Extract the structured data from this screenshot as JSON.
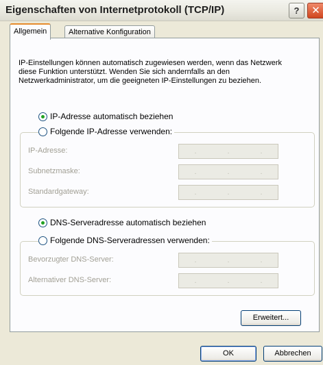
{
  "window": {
    "title": "Eigenschaften von Internetprotokoll (TCP/IP)",
    "help_button": "?",
    "close_button": "✕"
  },
  "tabs": [
    {
      "label": "Allgemein",
      "active": true
    },
    {
      "label": "Alternative Konfiguration",
      "active": false
    }
  ],
  "intro_text": "IP-Einstellungen können automatisch zugewiesen werden, wenn das Netzwerk diese Funktion unterstützt. Wenden Sie sich andernfalls an den Netzwerkadministrator, um die geeigneten IP-Einstellungen zu beziehen.",
  "ip_section": {
    "auto_option": "IP-Adresse automatisch beziehen",
    "manual_option": "Folgende IP-Adresse verwenden:",
    "selected": "auto",
    "fields": [
      {
        "label": "IP-Adresse:"
      },
      {
        "label": "Subnetzmaske:"
      },
      {
        "label": "Standardgateway:"
      }
    ]
  },
  "dns_section": {
    "auto_option": "DNS-Serveradresse automatisch beziehen",
    "manual_option": "Folgende DNS-Serveradressen verwenden:",
    "selected": "auto",
    "fields": [
      {
        "label": "Bevorzugter DNS-Server:"
      },
      {
        "label": "Alternativer DNS-Server:"
      }
    ]
  },
  "buttons": {
    "advanced": "Erweitert...",
    "ok": "OK",
    "cancel": "Abbrechen"
  },
  "colors": {
    "dialog_bg": "#ece9d8",
    "panel_bg": "#fcfcfe",
    "radio_dot": "#21a121",
    "tab_highlight": "#e68b2c",
    "pointer_fill": "#ffffcc"
  }
}
